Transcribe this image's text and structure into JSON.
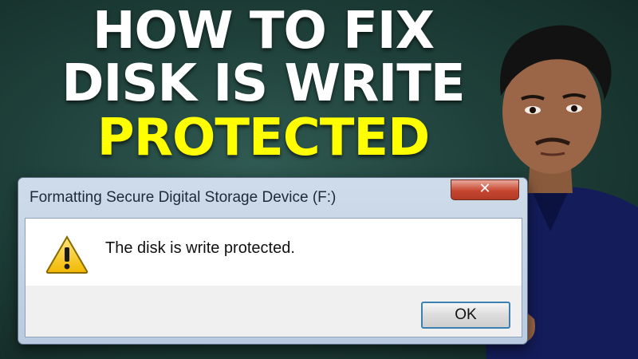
{
  "headline": {
    "line1": "HOW TO FIX",
    "line2": "DISK IS WRITE",
    "line3": "PROTECTED"
  },
  "dialog": {
    "title": "Formatting Secure Digital Storage Device (F:)",
    "close_label": "✕",
    "message": "The disk is write protected.",
    "ok_label": "OK",
    "icon": "warning-icon"
  },
  "colors": {
    "background": "#1f403a",
    "headline_white": "#ffffff",
    "headline_yellow": "#ffff00",
    "close_button": "#c7462f",
    "ok_border": "#3c7fb1"
  }
}
